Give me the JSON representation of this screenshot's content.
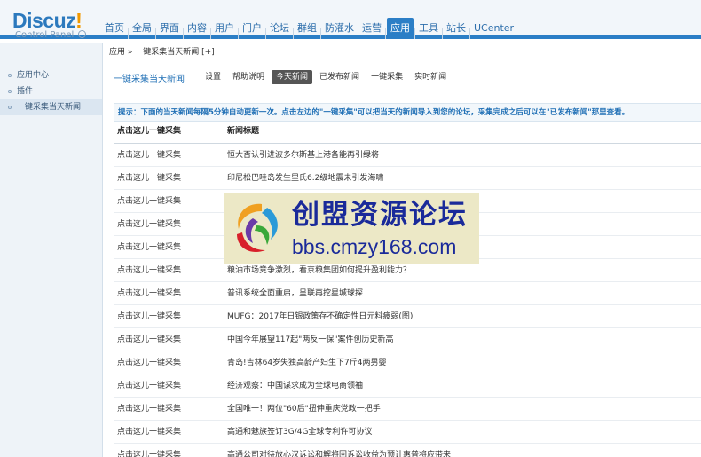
{
  "header": {
    "logo_main": "Discuz",
    "logo_bang": "!",
    "logo_sub": "Control Panel",
    "nav": [
      {
        "label": "首页",
        "active": false
      },
      {
        "label": "全局",
        "active": false
      },
      {
        "label": "界面",
        "active": false
      },
      {
        "label": "内容",
        "active": false
      },
      {
        "label": "用户",
        "active": false
      },
      {
        "label": "门户",
        "active": false
      },
      {
        "label": "论坛",
        "active": false
      },
      {
        "label": "群组",
        "active": false
      },
      {
        "label": "防灌水",
        "active": false
      },
      {
        "label": "运营",
        "active": false
      },
      {
        "label": "应用",
        "active": true
      },
      {
        "label": "工具",
        "active": false
      },
      {
        "label": "站长",
        "active": false
      },
      {
        "label": "UCenter",
        "active": false
      }
    ]
  },
  "sidebar": {
    "items": [
      {
        "label": "应用中心",
        "active": false
      },
      {
        "label": "插件",
        "active": false
      },
      {
        "label": "一键采集当天新闻",
        "active": true
      }
    ]
  },
  "breadcrumb": "应用 » 一键采集当天新闻  [+]",
  "subnav": {
    "title": "一键采集当天新闻",
    "tabs": [
      {
        "label": "设置",
        "active": false
      },
      {
        "label": "帮助说明",
        "active": false
      },
      {
        "label": "今天新闻",
        "active": true
      },
      {
        "label": "已发布新闻",
        "active": false
      },
      {
        "label": "一键采集",
        "active": false
      },
      {
        "label": "实时新闻",
        "active": false
      }
    ]
  },
  "tip": "提示：下面的当天新闻每隔5分钟自动更新一次。点击左边的\"一键采集\"可以把当天的新闻导入到您的论坛，采集完成之后可以在\"已发布新闻\"那里查看。",
  "table": {
    "headers": [
      "点击这儿一键采集",
      "新闻标题"
    ],
    "rows": [
      {
        "action": "点击这儿一键采集",
        "title": "恒大否认引进波多尔斯基上港备能再引绿将"
      },
      {
        "action": "点击这儿一键采集",
        "title": "印尼松巴哇岛发生里氏6.2级地震未引发海啸"
      },
      {
        "action": "点击这儿一键采集",
        "title": ""
      },
      {
        "action": "点击这儿一键采集",
        "title": ""
      },
      {
        "action": "点击这儿一键采集",
        "title": ""
      },
      {
        "action": "点击这儿一键采集",
        "title": "粮油市场竞争激烈，看京粮集团如何提升盈利能力？"
      },
      {
        "action": "点击这儿一键采集",
        "title": "普讯系统全面重启，呈联再挖星城球探"
      },
      {
        "action": "点击这儿一键采集",
        "title": "MUFG：2017年日银政策存不确定性日元料疲弱(图)"
      },
      {
        "action": "点击这儿一键采集",
        "title": "中国今年展望117起\"两反一保\"案件创历史新高"
      },
      {
        "action": "点击这儿一键采集",
        "title": "青岛!吉林64岁失独高龄产妇生下7斤4两男婴"
      },
      {
        "action": "点击这儿一键采集",
        "title": "经济观察：中国谋求成为全球电商领袖"
      },
      {
        "action": "点击这儿一键采集",
        "title": "全国唯一！两位\"60后\"扭伸重庆党政一把手"
      },
      {
        "action": "点击这儿一键采集",
        "title": "高通和魅族签订3G/4G全球专利许可协议"
      },
      {
        "action": "点击这儿一键采集",
        "title": "高通公司对待放心汉诉讼和解将回诉讼收益为预计惠普将应带来"
      }
    ]
  },
  "watermark": {
    "title": "创盟资源论坛",
    "url": "bbs.cmzy168.com"
  },
  "colors": {
    "accent": "#2b7ec6",
    "link": "#1f6fb5",
    "watermark_text": "#1a2a9a"
  }
}
